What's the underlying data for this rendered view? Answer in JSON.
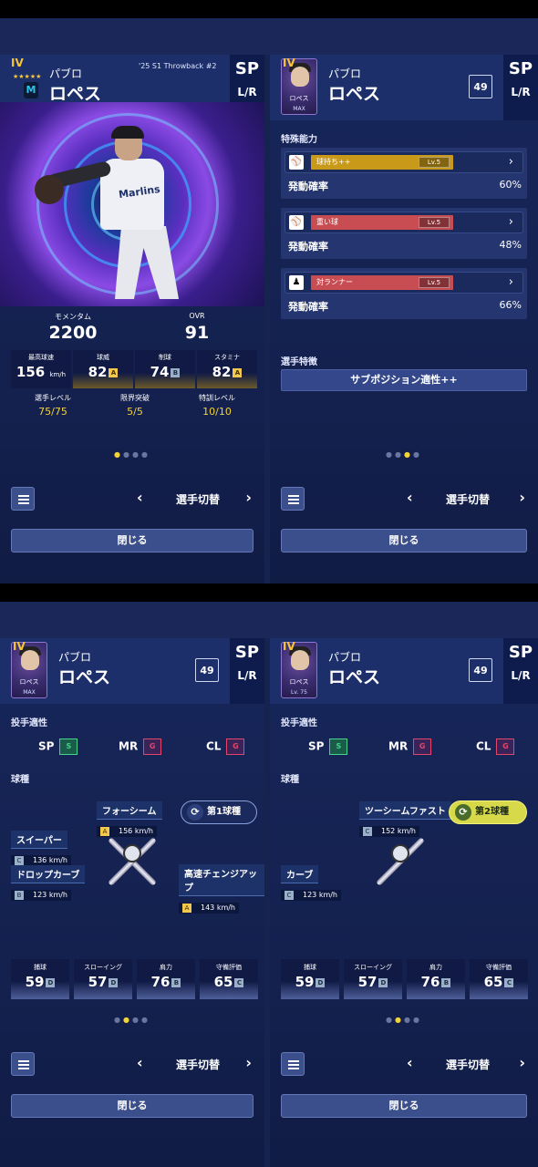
{
  "common": {
    "first_name": "パブロ",
    "last_name": "ロペス",
    "position": "SP",
    "hand": "L/R",
    "number": "49",
    "tier": "IV",
    "stars": "★★★★★",
    "nav_label": "選手切替",
    "prev": "‹",
    "next": "›",
    "close_label": "閉じる",
    "dot": "●"
  },
  "card1": {
    "series": "'25 S1 Throwback #2",
    "team_text": "Marlins",
    "momentum_label": "モメンタム",
    "momentum_value": "2200",
    "ovr_label": "OVR",
    "ovr_value": "91",
    "stats": [
      {
        "label": "最高球速",
        "value": "156",
        "unit": "km/h",
        "grade": ""
      },
      {
        "label": "球威",
        "value": "82",
        "unit": "",
        "grade": "A"
      },
      {
        "label": "制球",
        "value": "74",
        "unit": "",
        "grade": "B"
      },
      {
        "label": "スタミナ",
        "value": "82",
        "unit": "",
        "grade": "A"
      }
    ],
    "levels": [
      {
        "label": "選手レベル",
        "value": "75/75"
      },
      {
        "label": "限界突破",
        "value": "5/5"
      },
      {
        "label": "特訓レベル",
        "value": "10/10"
      }
    ]
  },
  "card2": {
    "avatar_name": "ロペス",
    "avatar_sub": "MAX",
    "special_title": "特殊能力",
    "rate_label": "発動確率",
    "abilities": [
      {
        "name": "球持ち++",
        "level": "Lv.5",
        "rate": "60%",
        "color": "#c99a1a",
        "icon": "⚾"
      },
      {
        "name": "重い球",
        "level": "Lv.5",
        "rate": "48%",
        "color": "#c84d53",
        "icon": "⚾"
      },
      {
        "name": "対ランナー",
        "level": "Lv.5",
        "rate": "66%",
        "color": "#c84d53",
        "icon": "♟"
      }
    ],
    "traits_title": "選手特徴",
    "trait_button": "サブポジション適性++"
  },
  "card3": {
    "avatar_name": "ロペス",
    "avatar_sub": "MAX",
    "aptitude_title": "投手適性",
    "aptitudes": [
      {
        "pos": "SP",
        "grade": "S"
      },
      {
        "pos": "MR",
        "grade": "G"
      },
      {
        "pos": "CL",
        "grade": "G"
      }
    ],
    "pitch_title": "球種",
    "pitch_main_badge": "第1球種",
    "pitches": [
      {
        "name": "フォーシーム",
        "grade": "A",
        "speed": "156 km/h"
      },
      {
        "name": "スイーパー",
        "grade": "C",
        "speed": "136 km/h"
      },
      {
        "name": "ドロップカーブ",
        "grade": "B",
        "speed": "123 km/h"
      },
      {
        "name": "高速チェンジアップ",
        "grade": "A",
        "speed": "143 km/h"
      }
    ],
    "fielding": [
      {
        "label": "捕球",
        "value": "59",
        "grade": "D"
      },
      {
        "label": "スローイング",
        "value": "57",
        "grade": "D"
      },
      {
        "label": "肩力",
        "value": "76",
        "grade": "B"
      },
      {
        "label": "守備評価",
        "value": "65",
        "grade": "C"
      }
    ]
  },
  "card4": {
    "avatar_name": "ロペス",
    "avatar_sub": "Lv. 75",
    "aptitude_title": "投手適性",
    "aptitudes": [
      {
        "pos": "SP",
        "grade": "S"
      },
      {
        "pos": "MR",
        "grade": "G"
      },
      {
        "pos": "CL",
        "grade": "G"
      }
    ],
    "pitch_title": "球種",
    "pitch_main_badge": "第2球種",
    "pitches": [
      {
        "name": "ツーシームファスト",
        "grade": "C",
        "speed": "152 km/h"
      },
      {
        "name": "カーブ",
        "grade": "C",
        "speed": "123 km/h"
      }
    ],
    "fielding": [
      {
        "label": "捕球",
        "value": "59",
        "grade": "D"
      },
      {
        "label": "スローイング",
        "value": "57",
        "grade": "D"
      },
      {
        "label": "肩力",
        "value": "76",
        "grade": "B"
      },
      {
        "label": "守備評価",
        "value": "65",
        "grade": "C"
      }
    ]
  }
}
